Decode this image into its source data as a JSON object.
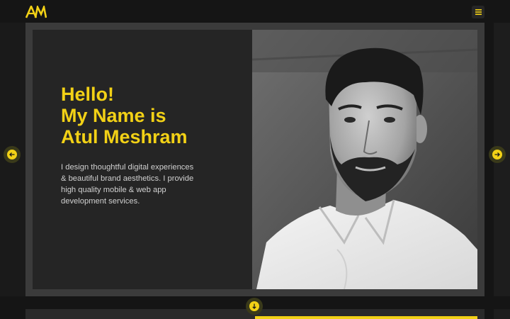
{
  "brand": {
    "logo_text": "AM",
    "accent_color": "#f2d116"
  },
  "header": {
    "menu_icon": "hamburger-icon"
  },
  "hero": {
    "greeting": "Hello!",
    "name_line_1": "My Name is",
    "name_line_2": "Atul Meshram",
    "description": "I design thoughtful digital experiences & beautiful brand aesthetics. I provide high quality mobile & web app development services.",
    "photo": "portrait-photo"
  },
  "navigation": {
    "prev_icon": "arrow-left-icon",
    "next_icon": "arrow-right-icon",
    "scroll_icon": "scroll-down-icon"
  },
  "colors": {
    "background": "#151515",
    "card": "#3b3b3b",
    "panel": "#252525",
    "text": "#d0d0d0"
  }
}
